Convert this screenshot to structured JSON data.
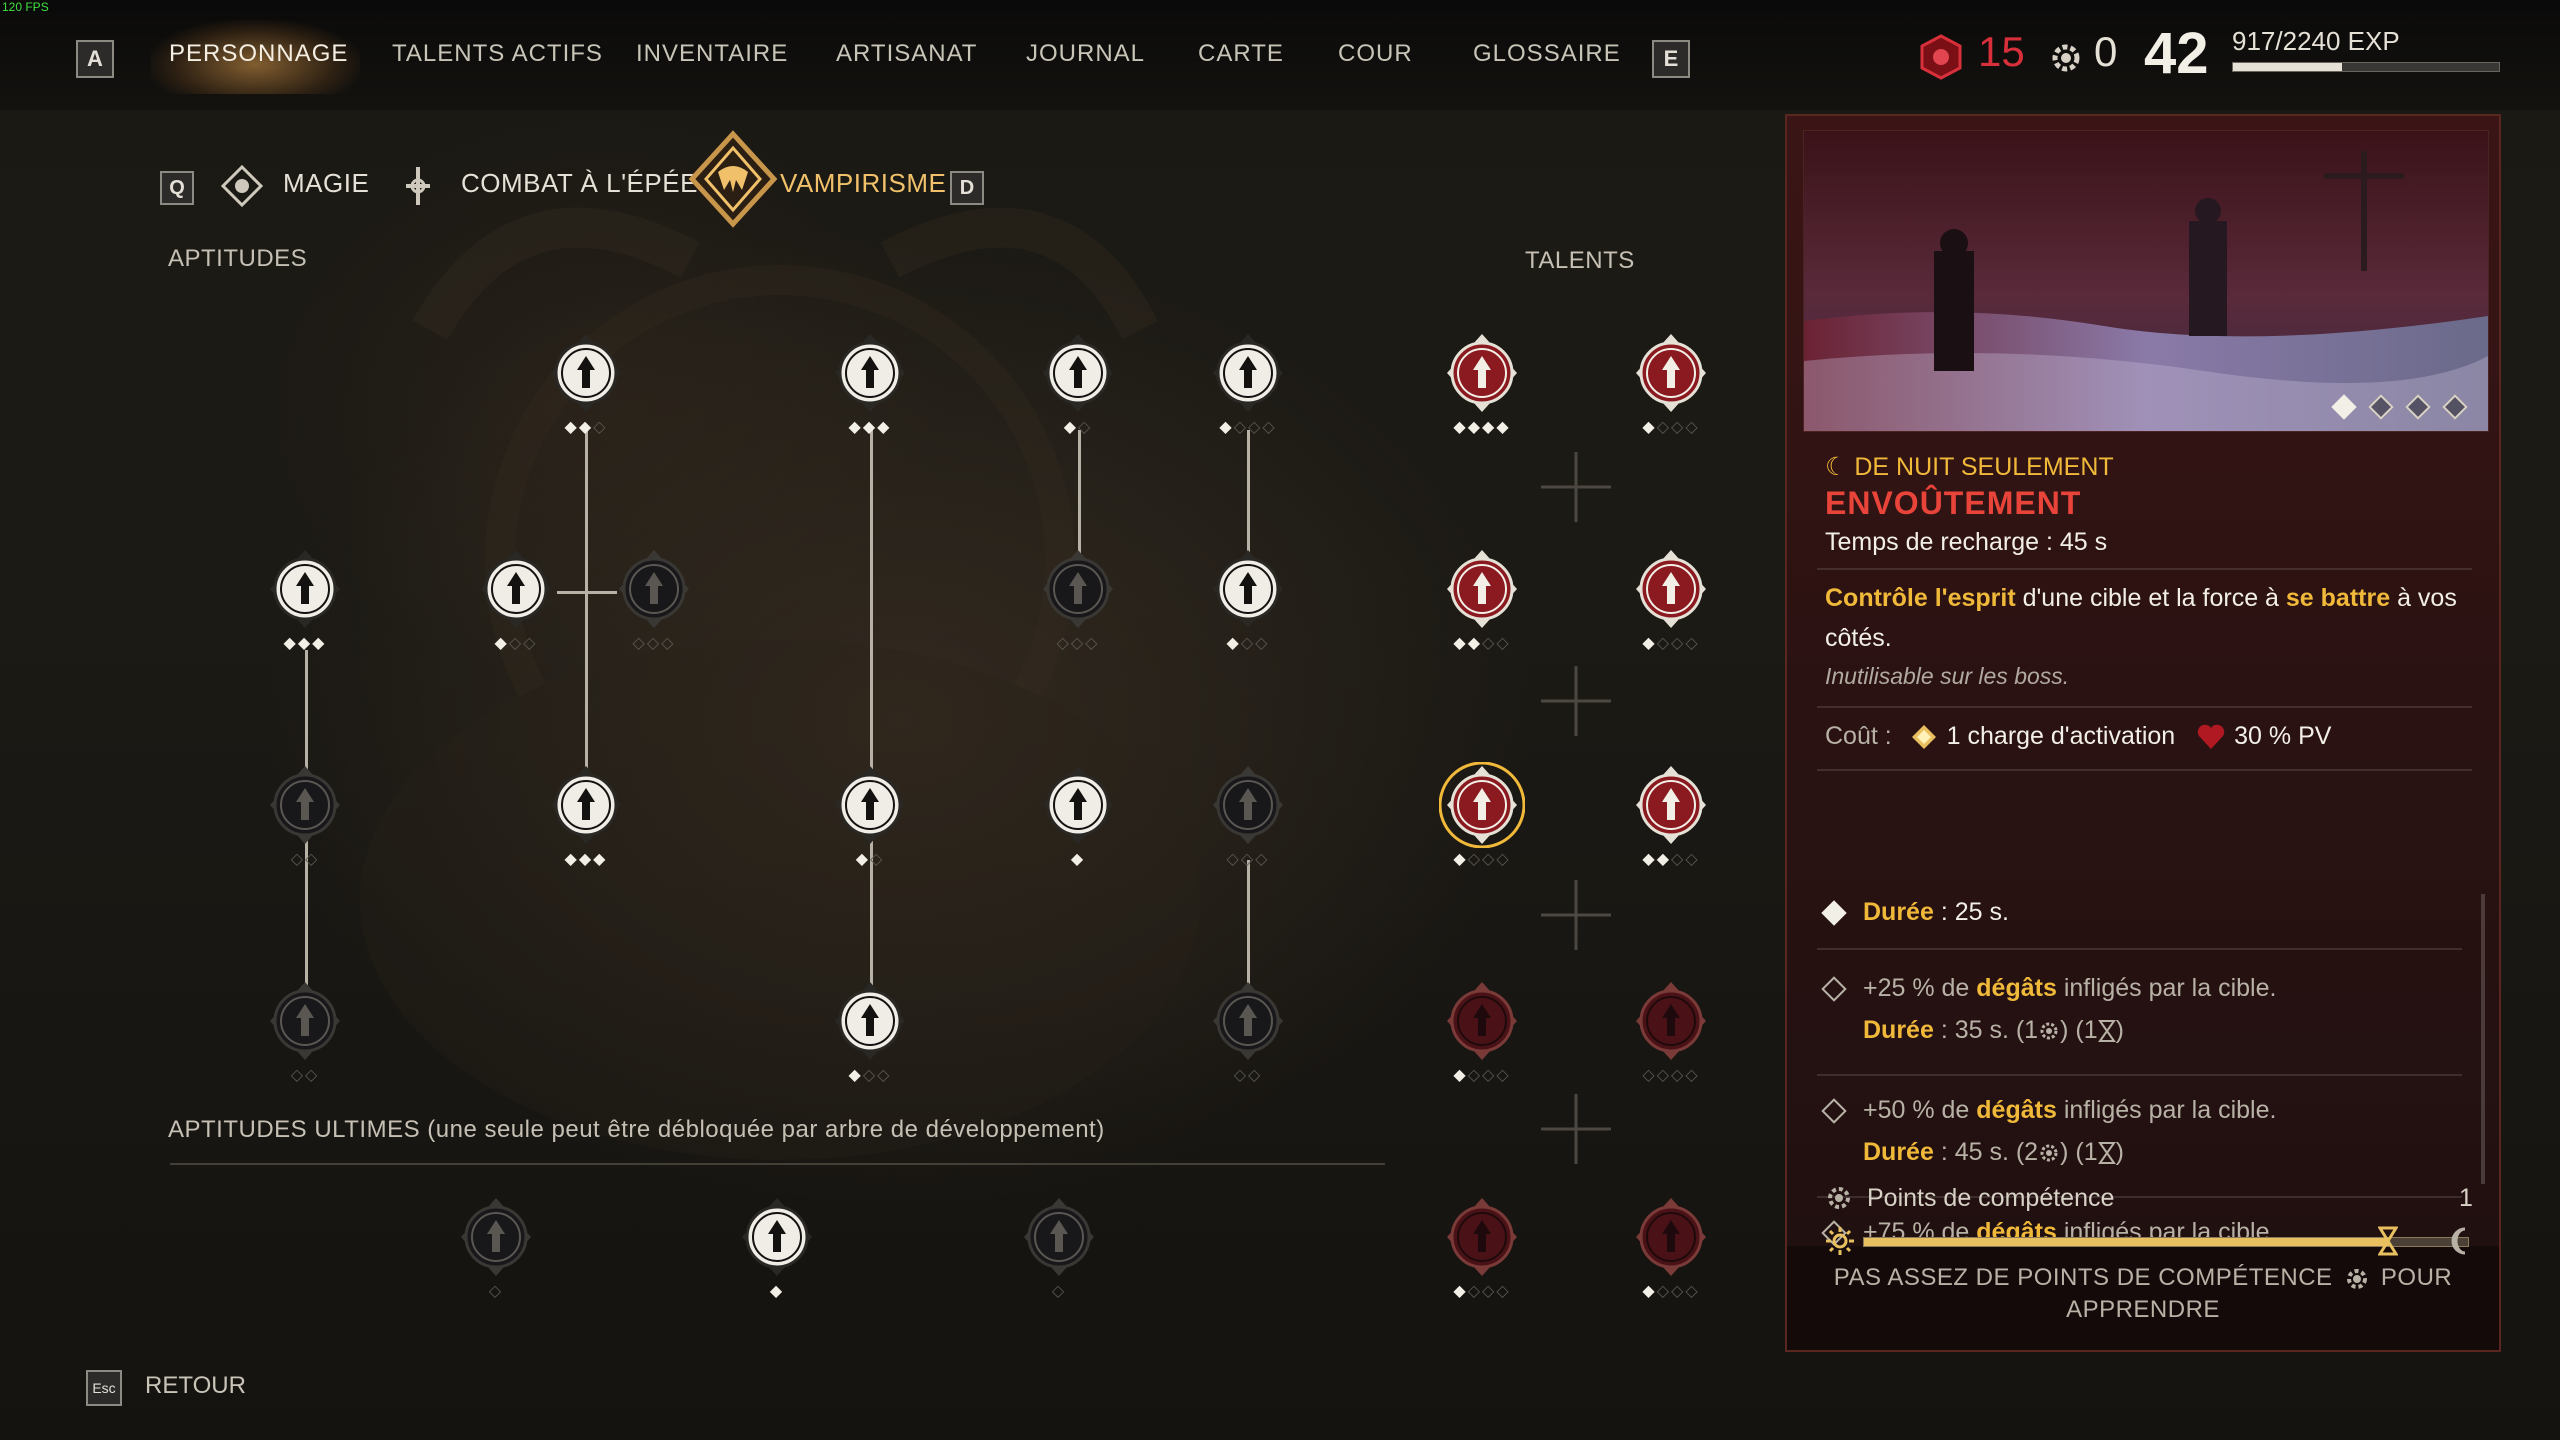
{
  "fps": "120 FPS",
  "nav": {
    "key_left": "A",
    "key_right": "E",
    "tabs": [
      "PERSONNAGE",
      "TALENTS ACTIFS",
      "INVENTAIRE",
      "ARTISANAT",
      "JOURNAL",
      "CARTE",
      "COUR",
      "GLOSSAIRE"
    ],
    "active_tab": "PERSONNAGE"
  },
  "stats": {
    "blood": "15",
    "points": "0",
    "level": "42",
    "exp": "917/2240 EXP",
    "exp_progress": 0.41,
    "blood_color": "#d8303a"
  },
  "subtabs": {
    "key_left": "Q",
    "key_right": "D",
    "items": [
      "MAGIE",
      "COMBAT À L'ÉPÉE",
      "VAMPIRISME"
    ],
    "active": "VAMPIRISME",
    "active_color": "#f0c06a"
  },
  "sections": {
    "aptitudes": "APTITUDES",
    "talents": "TALENTS",
    "ultimes": "APTITUDES ULTIMES (une seule peut être débloquée par arbre de développement)"
  },
  "aptitude_nodes": [
    {
      "icon": "blood-drop-swirl-icon",
      "ranks": 3,
      "filled": 2
    },
    {
      "icon": "vampire-fangs-icon",
      "ranks": 3,
      "filled": 3
    },
    {
      "icon": "eye-sigil-icon",
      "ranks": 2,
      "filled": 1
    },
    {
      "icon": "blood-rain-icon",
      "ranks": 4,
      "filled": 1
    },
    {
      "icon": "flame-hand-icon",
      "ranks": 3,
      "filled": 3
    },
    {
      "icon": "fanged-maw-icon",
      "ranks": 3,
      "filled": 1
    },
    {
      "icon": "dark-sun-icon",
      "ranks": 3,
      "filled": 0
    },
    {
      "icon": "bat-swarm-icon",
      "ranks": 3,
      "filled": 0
    },
    {
      "icon": "claw-slash-icon",
      "ranks": 3,
      "filled": 1
    },
    {
      "icon": "blood-drops-icon",
      "ranks": 2,
      "filled": 0
    },
    {
      "icon": "bleeding-hand-icon",
      "ranks": 3,
      "filled": 3
    },
    {
      "icon": "triple-slash-icon",
      "ranks": 2,
      "filled": 1
    },
    {
      "icon": "blood-rose-icon",
      "ranks": 1,
      "filled": 1
    },
    {
      "icon": "claws-icon",
      "ranks": 3,
      "filled": 0
    },
    {
      "icon": "dark-eye-icon",
      "ranks": 2,
      "filled": 0
    },
    {
      "icon": "drop-hand-icon",
      "ranks": 3,
      "filled": 1
    },
    {
      "icon": "beast-claw-icon",
      "ranks": 2,
      "filled": 0
    }
  ],
  "talent_nodes": [
    {
      "icon": "blood-flower-icon",
      "ranks": 4,
      "filled": 4
    },
    {
      "icon": "raven-icon",
      "ranks": 4,
      "filled": 1
    },
    {
      "icon": "wolf-head-icon",
      "ranks": 4,
      "filled": 2
    },
    {
      "icon": "spiked-heart-icon",
      "ranks": 4,
      "filled": 1
    },
    {
      "icon": "spiral-eye-icon",
      "ranks": 4,
      "filled": 1,
      "selected": true
    },
    {
      "icon": "winged-fist-icon",
      "ranks": 4,
      "filled": 2
    },
    {
      "icon": "demon-face-icon",
      "ranks": 4,
      "filled": 1
    },
    {
      "icon": "blood-heart-icon",
      "ranks": 4,
      "filled": 0
    },
    {
      "icon": "blood-slash-icon",
      "ranks": 4,
      "filled": 1
    },
    {
      "icon": "wolf-claw-icon",
      "ranks": 4,
      "filled": 1
    }
  ],
  "ultimate_nodes": [
    {
      "icon": "skull-icon",
      "ranks": 1,
      "filled": 0
    },
    {
      "icon": "soul-hand-icon",
      "ranks": 1,
      "filled": 1
    },
    {
      "icon": "rune-circle-icon",
      "ranks": 1,
      "filled": 0
    }
  ],
  "detail": {
    "tag": "☾ DE NUIT SEULEMENT",
    "name": "ENVOÛTEMENT",
    "cooldown": "Temps de recharge : 45 s",
    "desc_hl1": "Contrôle l'esprit",
    "desc_mid1": " d'une cible et la force à ",
    "desc_hl2": "se battre",
    "desc_mid2": " à vos",
    "desc_line2": "côtés.",
    "note": "Inutilisable sur les boss.",
    "cost_label": "Coût :",
    "cost_charge": "1 charge d'activation",
    "cost_hp": "30 % PV",
    "rank1_label": "Durée",
    "rank1_value": " : 25 s.",
    "rank2_prefix": "+25 % de ",
    "rank2_hl": "dégâts",
    "rank2_suffix": " infligés par la cible.",
    "rank2_dur_label": "Durée",
    "rank2_dur_value": " : 35 s.  (1",
    "rank2_tail_a": ") (1",
    "rank2_tail_b": ")",
    "rank3_prefix": "+50 % de ",
    "rank3_hl": "dégâts",
    "rank3_suffix": " infligés par la cible.",
    "rank3_dur_label": "Durée",
    "rank3_dur_value": " : 45 s.  (2",
    "rank3_tail_a": ") (1",
    "rank3_tail_b": ")",
    "rank4_prefix": "+75 % de ",
    "rank4_hl": "dégâts",
    "rank4_suffix": " infligés par la cible.",
    "skill_points_label": "Points de compétence",
    "skill_points_value": "1",
    "cycle_progress": 0.87,
    "warning_line1": "PAS ASSEZ DE POINTS DE COMPÉTENCE",
    "warning_pour": "POUR",
    "warning_line2": "APPRENDRE",
    "preview_pages": 4,
    "preview_page_active": 1
  },
  "footer": {
    "key": "Esc",
    "back": "RETOUR"
  }
}
